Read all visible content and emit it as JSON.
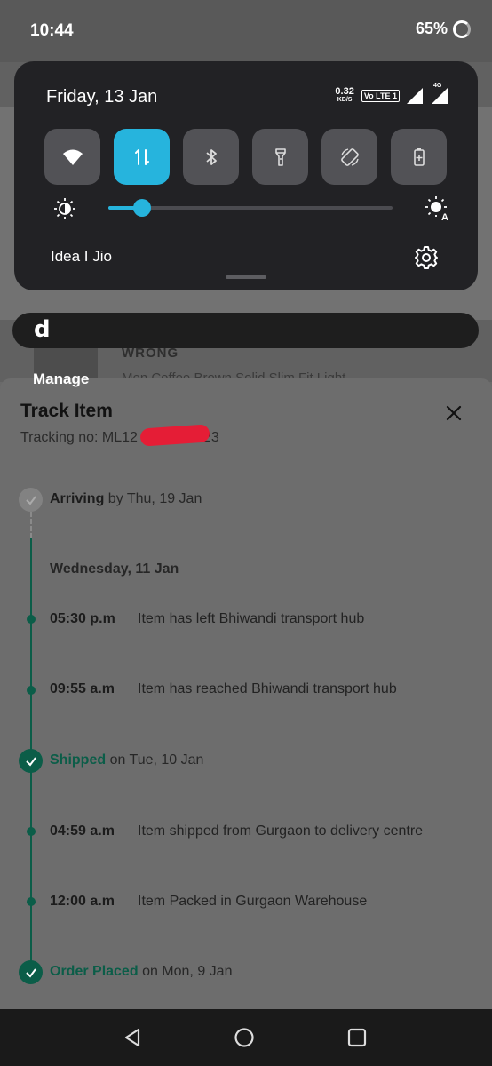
{
  "status_bar": {
    "time": "10:44",
    "battery": "65%"
  },
  "quick_settings": {
    "date": "Friday, 13 Jan",
    "net_speed": "0.32",
    "net_speed_unit": "KB/S",
    "volte_label": "Vo LTE 1",
    "network_label": "4G",
    "tiles": [
      {
        "icon": "wifi-icon",
        "active": false
      },
      {
        "icon": "mobile-data-icon",
        "active": true
      },
      {
        "icon": "bluetooth-icon",
        "active": false
      },
      {
        "icon": "flashlight-icon",
        "active": false
      },
      {
        "icon": "auto-rotate-icon",
        "active": false
      },
      {
        "icon": "battery-saver-icon",
        "active": false
      }
    ],
    "brightness_level": 0.12,
    "carrier": "Idea I Jio"
  },
  "background_app": {
    "brand": "WRONG",
    "product_fragment": "Men Coffee Brown Solid Slim Fit Light",
    "manage_label": "Manage"
  },
  "track_sheet": {
    "title": "Track Item",
    "tracking_label": "Tracking no: ML12",
    "tracking_suffix": "23",
    "events": {
      "arriving": {
        "label": "Arriving",
        "detail": "by Thu, 19 Jan"
      },
      "day_header": "Wednesday, 11 Jan",
      "e1": {
        "time": "05:30 p.m",
        "desc": "Item has left Bhiwandi transport hub"
      },
      "e2": {
        "time": "09:55 a.m",
        "desc": "Item has reached Bhiwandi transport hub"
      },
      "shipped": {
        "label": "Shipped",
        "detail": "on Tue, 10 Jan"
      },
      "e3": {
        "time": "04:59 a.m",
        "desc": "Item shipped from Gurgaon to delivery centre"
      },
      "e4": {
        "time": "12:00 a.m",
        "desc": "Item Packed in Gurgaon Warehouse"
      },
      "placed": {
        "label": "Order Placed",
        "detail": "on Mon, 9 Jan"
      }
    }
  },
  "colors": {
    "accent": "#26b4dd",
    "track_green": "#0b5d48",
    "redaction": "#e51d36"
  }
}
